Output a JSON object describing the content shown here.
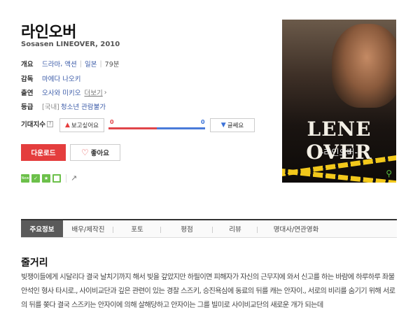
{
  "movie": {
    "title": "라인오버",
    "original": "Sosasen LINEOVER, 2010"
  },
  "info": {
    "overview_label": "개요",
    "genres": [
      "드라마",
      "액션"
    ],
    "country": "일본",
    "runtime": "79분",
    "director_label": "감독",
    "director": "마에다 나오키",
    "cast_label": "출연",
    "cast": "오사와 미키오",
    "more": "더보기",
    "rating_label": "등급",
    "rating_prefix": "[국내]",
    "rating": "청소년 관람불가"
  },
  "expectation": {
    "label": "기대지수",
    "help": "?",
    "want_label": "보고싶어요",
    "want_count": "0",
    "nowant_label": "글쎄요",
    "nowant_count": "0",
    "want_ratio": 0.5,
    "colors": {
      "want": "#e0454a",
      "nowant": "#4a7bd9"
    }
  },
  "actions": {
    "download": "다운로드",
    "like": "좋아요"
  },
  "badges": {
    "new": "New"
  },
  "poster": {
    "title": "LENE OVER",
    "subtitle": "-라인오버-"
  },
  "tabs": [
    "주요정보",
    "배우/제작진",
    "포토",
    "평점",
    "리뷰",
    "명대사/연관영화"
  ],
  "synopsis": {
    "heading": "줄거리",
    "text": "빚쟁이들에게 시달리다 결국 날치기까지 해서 빚을 갚았지만 하필이면 피해자가 자신의 근무지에 와서 신고를 하는 바람에 하루하루 좌불안석인 형사 타시로., 사이비교단과 깊은 관련이 있는 경찰 스즈키, 승진욕심에 동료의 뒤를 캐는 안자이., 서로의 비리를 숨기기 위해 서로의 뒤를 쫒다 결국 스즈키는 안자이에 의해 살해당하고 안자이는 그를 빌미로 사이비교단의 새로운 개가 되는데"
  }
}
